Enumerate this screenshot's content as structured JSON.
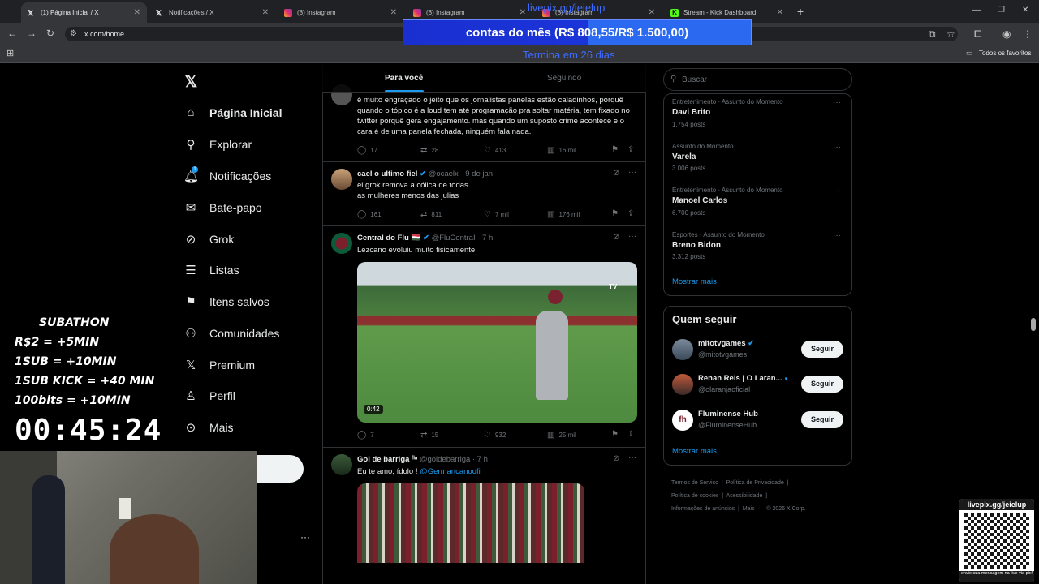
{
  "browser": {
    "tabs": [
      {
        "title": "(1) Página Inicial / X",
        "icon": "x-icon",
        "active": true
      },
      {
        "title": "Notificações / X",
        "icon": "x-icon",
        "active": false
      },
      {
        "title": "(8) Instagram",
        "icon": "instagram-icon",
        "active": false
      },
      {
        "title": "(8) Instagram",
        "icon": "instagram-icon",
        "active": false
      },
      {
        "title": "(8) Instagram",
        "icon": "instagram-icon",
        "active": false
      },
      {
        "title": "Stream - Kick Dashboard",
        "icon": "kick-icon",
        "active": false
      }
    ],
    "url": "x.com/home",
    "bookmarks_label": "Todos os favoritos"
  },
  "overlay": {
    "livepix_top": "livepix.gg/jeielup",
    "donation_bar": "contas do mês (R$ 808,55/R$ 1.500,00)",
    "donation_progress": 0.539,
    "termina": "Termina em 26 dias",
    "subathon_title": "SUBATHON",
    "subathon_rules": [
      "R$2 = +5MIN",
      "1SUB  =  +10MIN",
      "1SUB KICK = +40 MIN",
      "100bits = +10MIN"
    ],
    "timer": "00:45:24",
    "qr_top": "livepix.gg/jeielup",
    "qr_bottom": "envie sua mensagem na live via pix!"
  },
  "nav": {
    "items": [
      {
        "label": "Página Inicial",
        "icon": "home-icon"
      },
      {
        "label": "Explorar",
        "icon": "search-icon"
      },
      {
        "label": "Notificações",
        "icon": "bell-icon"
      },
      {
        "label": "Bate-papo",
        "icon": "mail-icon"
      },
      {
        "label": "Grok",
        "icon": "grok-icon"
      },
      {
        "label": "Listas",
        "icon": "list-icon"
      },
      {
        "label": "Itens salvos",
        "icon": "bookmark-icon"
      },
      {
        "label": "Comunidades",
        "icon": "people-icon"
      },
      {
        "label": "Premium",
        "icon": "x-icon"
      },
      {
        "label": "Perfil",
        "icon": "person-icon"
      },
      {
        "label": "Mais",
        "icon": "more-icon"
      }
    ],
    "notification_badge": "1"
  },
  "feed": {
    "tabs": [
      "Para você",
      "Seguindo"
    ],
    "posts": [
      {
        "text": "é muito engraçado o jeito que os jornalistas panelas estão caladinhos, porquê quando o tópico é a loud tem até programação pra soltar matéria, tem fixado no twitter porquê gera engajamento. mas quando um suposto crime acontece e o cara é de uma panela fechada, ninguém fala nada.",
        "replies": "17",
        "reposts": "28",
        "likes": "413",
        "views": "16 mil"
      },
      {
        "name": "cael o ultimo fiel",
        "handle": "@ocaelx",
        "date": "· 9 de jan",
        "text_lines": [
          "el grok remova a cólica de todas",
          "as mulheres  menos das julias"
        ],
        "replies": "161",
        "reposts": "811",
        "likes": "7 mil",
        "views": "176 mil"
      },
      {
        "name": "Central do Flu 🇭🇺",
        "handle": "@FluCentraI",
        "date": "· 7 h",
        "text": "Lezcano evoluiu muito fisicamente",
        "video_duration": "0:42",
        "video_watermark": "TV",
        "replies": "7",
        "reposts": "15",
        "likes": "932",
        "views": "25 mil"
      },
      {
        "name": "Gol de barriga ᶠˡᵘ",
        "handle": "@goldebarriga",
        "date": "· 7 h",
        "text": "Eu te amo, ídolo ! ",
        "mention": "@Germancanoofi"
      }
    ]
  },
  "sidebar": {
    "search_placeholder": "Buscar",
    "trends": [
      {
        "category": "Entretenimento · Assunto do Momento",
        "name": "Davi Brito",
        "count": "1.754 posts"
      },
      {
        "category": "Assunto do Momento",
        "name": "Varela",
        "count": "3.006 posts"
      },
      {
        "category": "Entretenimento · Assunto do Momento",
        "name": "Manoel Carlos",
        "count": "6.700 posts"
      },
      {
        "category": "Esportes · Assunto do Momento",
        "name": "Breno Bidon",
        "count": "3.312 posts"
      }
    ],
    "show_more": "Mostrar mais",
    "who_to_follow_title": "Quem seguir",
    "follow": [
      {
        "name": "mitotvgames",
        "handle": "@mitotvgames",
        "button": "Seguir"
      },
      {
        "name": "Renan Reis | O Laran...",
        "handle": "@olaranjaoficial",
        "button": "Seguir"
      },
      {
        "name": "Fluminense Hub",
        "handle": "@FluminenseHub",
        "button": "Seguir"
      }
    ],
    "follow_show_more": "Mostrar mais",
    "footer": [
      "Termos de Serviço",
      "Política de Privacidade",
      "Política de cookies",
      "Acessibilidade",
      "Informações de anúncios",
      "Mais ···",
      "© 2026 X Corp."
    ]
  },
  "colors": {
    "accent": "#1d9bf0",
    "donation_bar": "#1b34d8",
    "verified": "#1d9bf0"
  }
}
